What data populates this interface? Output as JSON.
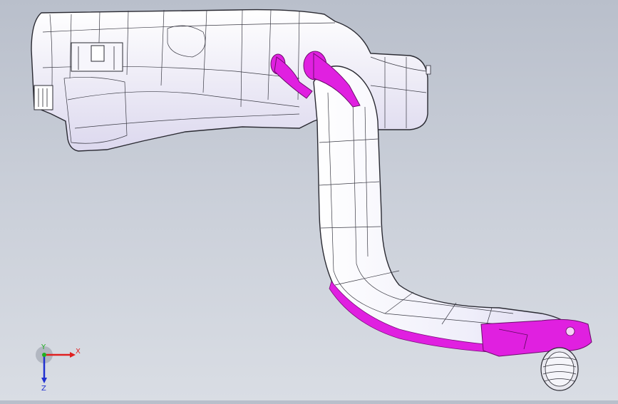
{
  "viewport": {
    "colors": {
      "background_top": "#b9bfcb",
      "background_bottom": "#d9dde4",
      "part_fill": "#f3f1fb",
      "part_edge": "#2a2a32",
      "highlight": "#e020e0"
    }
  },
  "triad": {
    "x_label": "X",
    "y_label": "Y",
    "z_label": "Z",
    "x_color": "#e02020",
    "y_color": "#20b020",
    "z_color": "#2030d0"
  }
}
